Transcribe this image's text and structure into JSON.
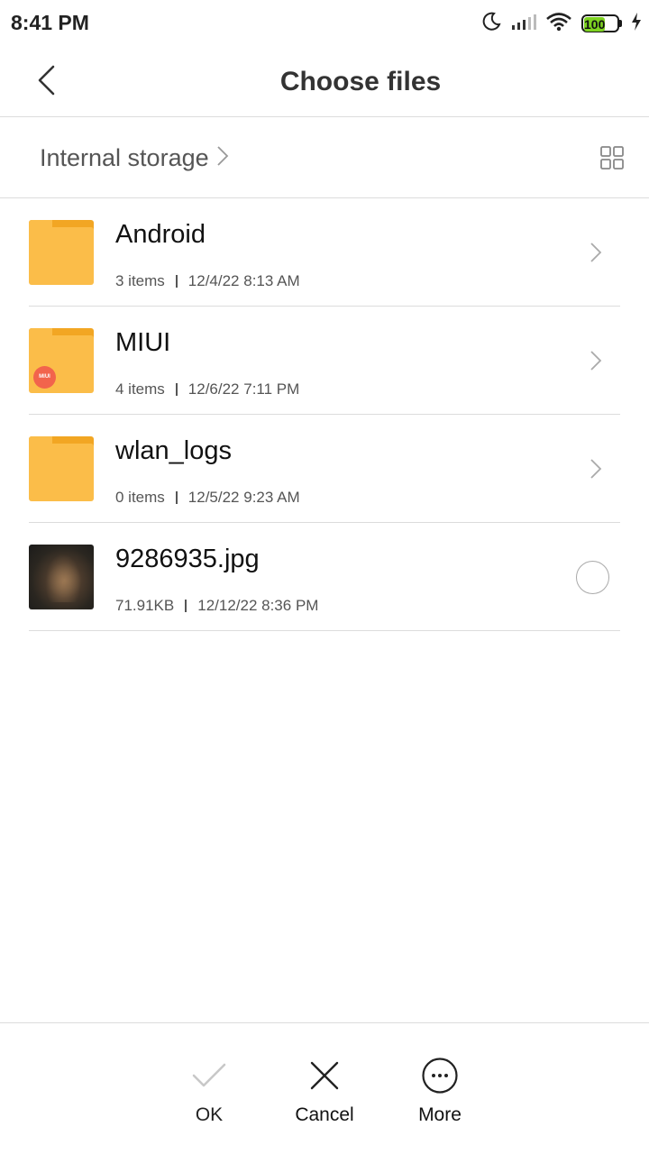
{
  "status_bar": {
    "time": "8:41 PM",
    "battery_level": "100",
    "icons": [
      "moon-icon",
      "signal-icon",
      "wifi-icon",
      "battery-icon",
      "charging-icon"
    ]
  },
  "header": {
    "title": "Choose files",
    "back_icon": "back-arrow-icon"
  },
  "breadcrumb": {
    "label": "Internal storage",
    "view_toggle_icon": "grid-view-icon"
  },
  "files": [
    {
      "name": "Android",
      "type": "folder",
      "count": "3 items",
      "date": "12/4/22 8:13 AM"
    },
    {
      "name": "MIUI",
      "type": "folder",
      "badge": "MIUI",
      "count": "4 items",
      "date": "12/6/22 7:11 PM"
    },
    {
      "name": "wlan_logs",
      "type": "folder",
      "count": "0 items",
      "date": "12/5/22 9:23 AM"
    },
    {
      "name": "9286935.jpg",
      "type": "image",
      "size": "71.91KB",
      "date": "12/12/22 8:36 PM"
    }
  ],
  "bottom_actions": {
    "ok": "OK",
    "cancel": "Cancel",
    "more": "More"
  },
  "colors": {
    "folder": "#fbbd49",
    "folder_tab": "#f2a623",
    "miui_badge": "#f2644c",
    "battery": "#7ed321",
    "divider": "#dcdcdc"
  }
}
